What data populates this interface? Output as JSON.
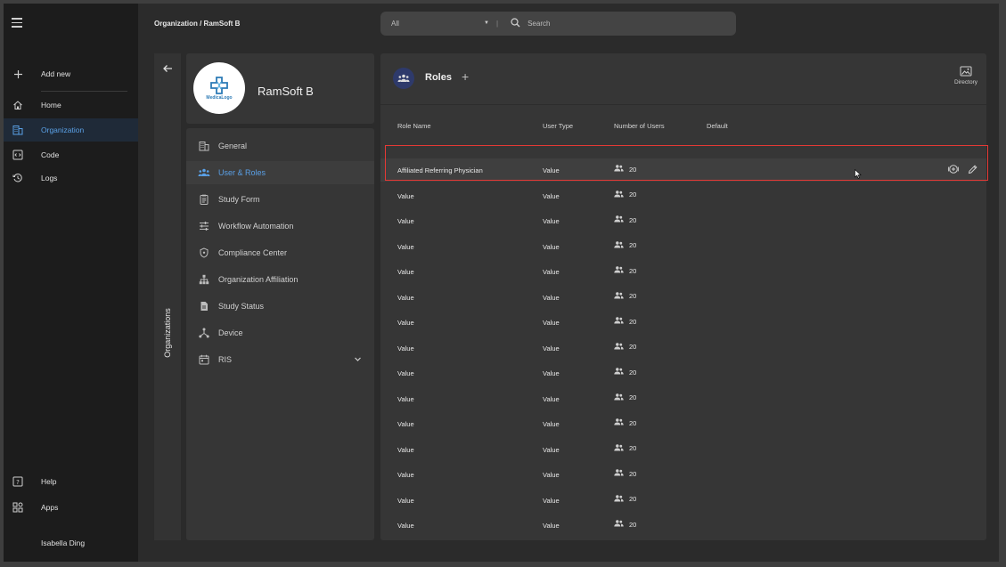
{
  "nav": {
    "add_new": "Add new",
    "items": [
      {
        "label": "Home",
        "icon": "home-icon"
      },
      {
        "label": "Organization",
        "icon": "organization-icon"
      },
      {
        "label": "Code",
        "icon": "code-icon"
      },
      {
        "label": "Logs",
        "icon": "history-icon"
      }
    ],
    "help": "Help",
    "apps": "Apps",
    "user": "Isabella Ding",
    "active_color": "#5aa0e6"
  },
  "breadcrumb": "Organization / RamSoft B",
  "search": {
    "filter_value": "All",
    "divider": "|",
    "placeholder": "Search"
  },
  "org_strip": {
    "label": "Organizations"
  },
  "org": {
    "name": "RamSoft B",
    "logo_text": "MedicaLogo"
  },
  "settings_menu": [
    {
      "label": "General",
      "icon": "building-icon"
    },
    {
      "label": "User & Roles",
      "icon": "users-roles-icon",
      "active": true
    },
    {
      "label": "Study Form",
      "icon": "clipboard-icon"
    },
    {
      "label": "Workflow Automation",
      "icon": "sliders-icon"
    },
    {
      "label": "Compliance Center",
      "icon": "shield-icon"
    },
    {
      "label": "Organization Affiliation",
      "icon": "hierarchy-icon"
    },
    {
      "label": "Study Status",
      "icon": "document-icon"
    },
    {
      "label": "Device",
      "icon": "device-network-icon"
    },
    {
      "label": "RIS",
      "icon": "calendar-icon"
    }
  ],
  "roles": {
    "title": "Roles",
    "add_symbol": "+",
    "directory_label": "Directory",
    "columns": [
      "Role Name",
      "User Type",
      "Number of Users",
      "Default"
    ],
    "rows": [
      {
        "name": "Affiliated Referring Physician",
        "type": "Value",
        "count": "20"
      },
      {
        "name": "Value",
        "type": "Value",
        "count": "20"
      },
      {
        "name": "Value",
        "type": "Value",
        "count": "20"
      },
      {
        "name": "Value",
        "type": "Value",
        "count": "20"
      },
      {
        "name": "Value",
        "type": "Value",
        "count": "20"
      },
      {
        "name": "Value",
        "type": "Value",
        "count": "20"
      },
      {
        "name": "Value",
        "type": "Value",
        "count": "20"
      },
      {
        "name": "Value",
        "type": "Value",
        "count": "20"
      },
      {
        "name": "Value",
        "type": "Value",
        "count": "20"
      },
      {
        "name": "Value",
        "type": "Value",
        "count": "20"
      },
      {
        "name": "Value",
        "type": "Value",
        "count": "20"
      },
      {
        "name": "Value",
        "type": "Value",
        "count": "20"
      },
      {
        "name": "Value",
        "type": "Value",
        "count": "20"
      },
      {
        "name": "Value",
        "type": "Value",
        "count": "20"
      },
      {
        "name": "Value",
        "type": "Value",
        "count": "20"
      }
    ],
    "highlight_color": "#e53935"
  }
}
